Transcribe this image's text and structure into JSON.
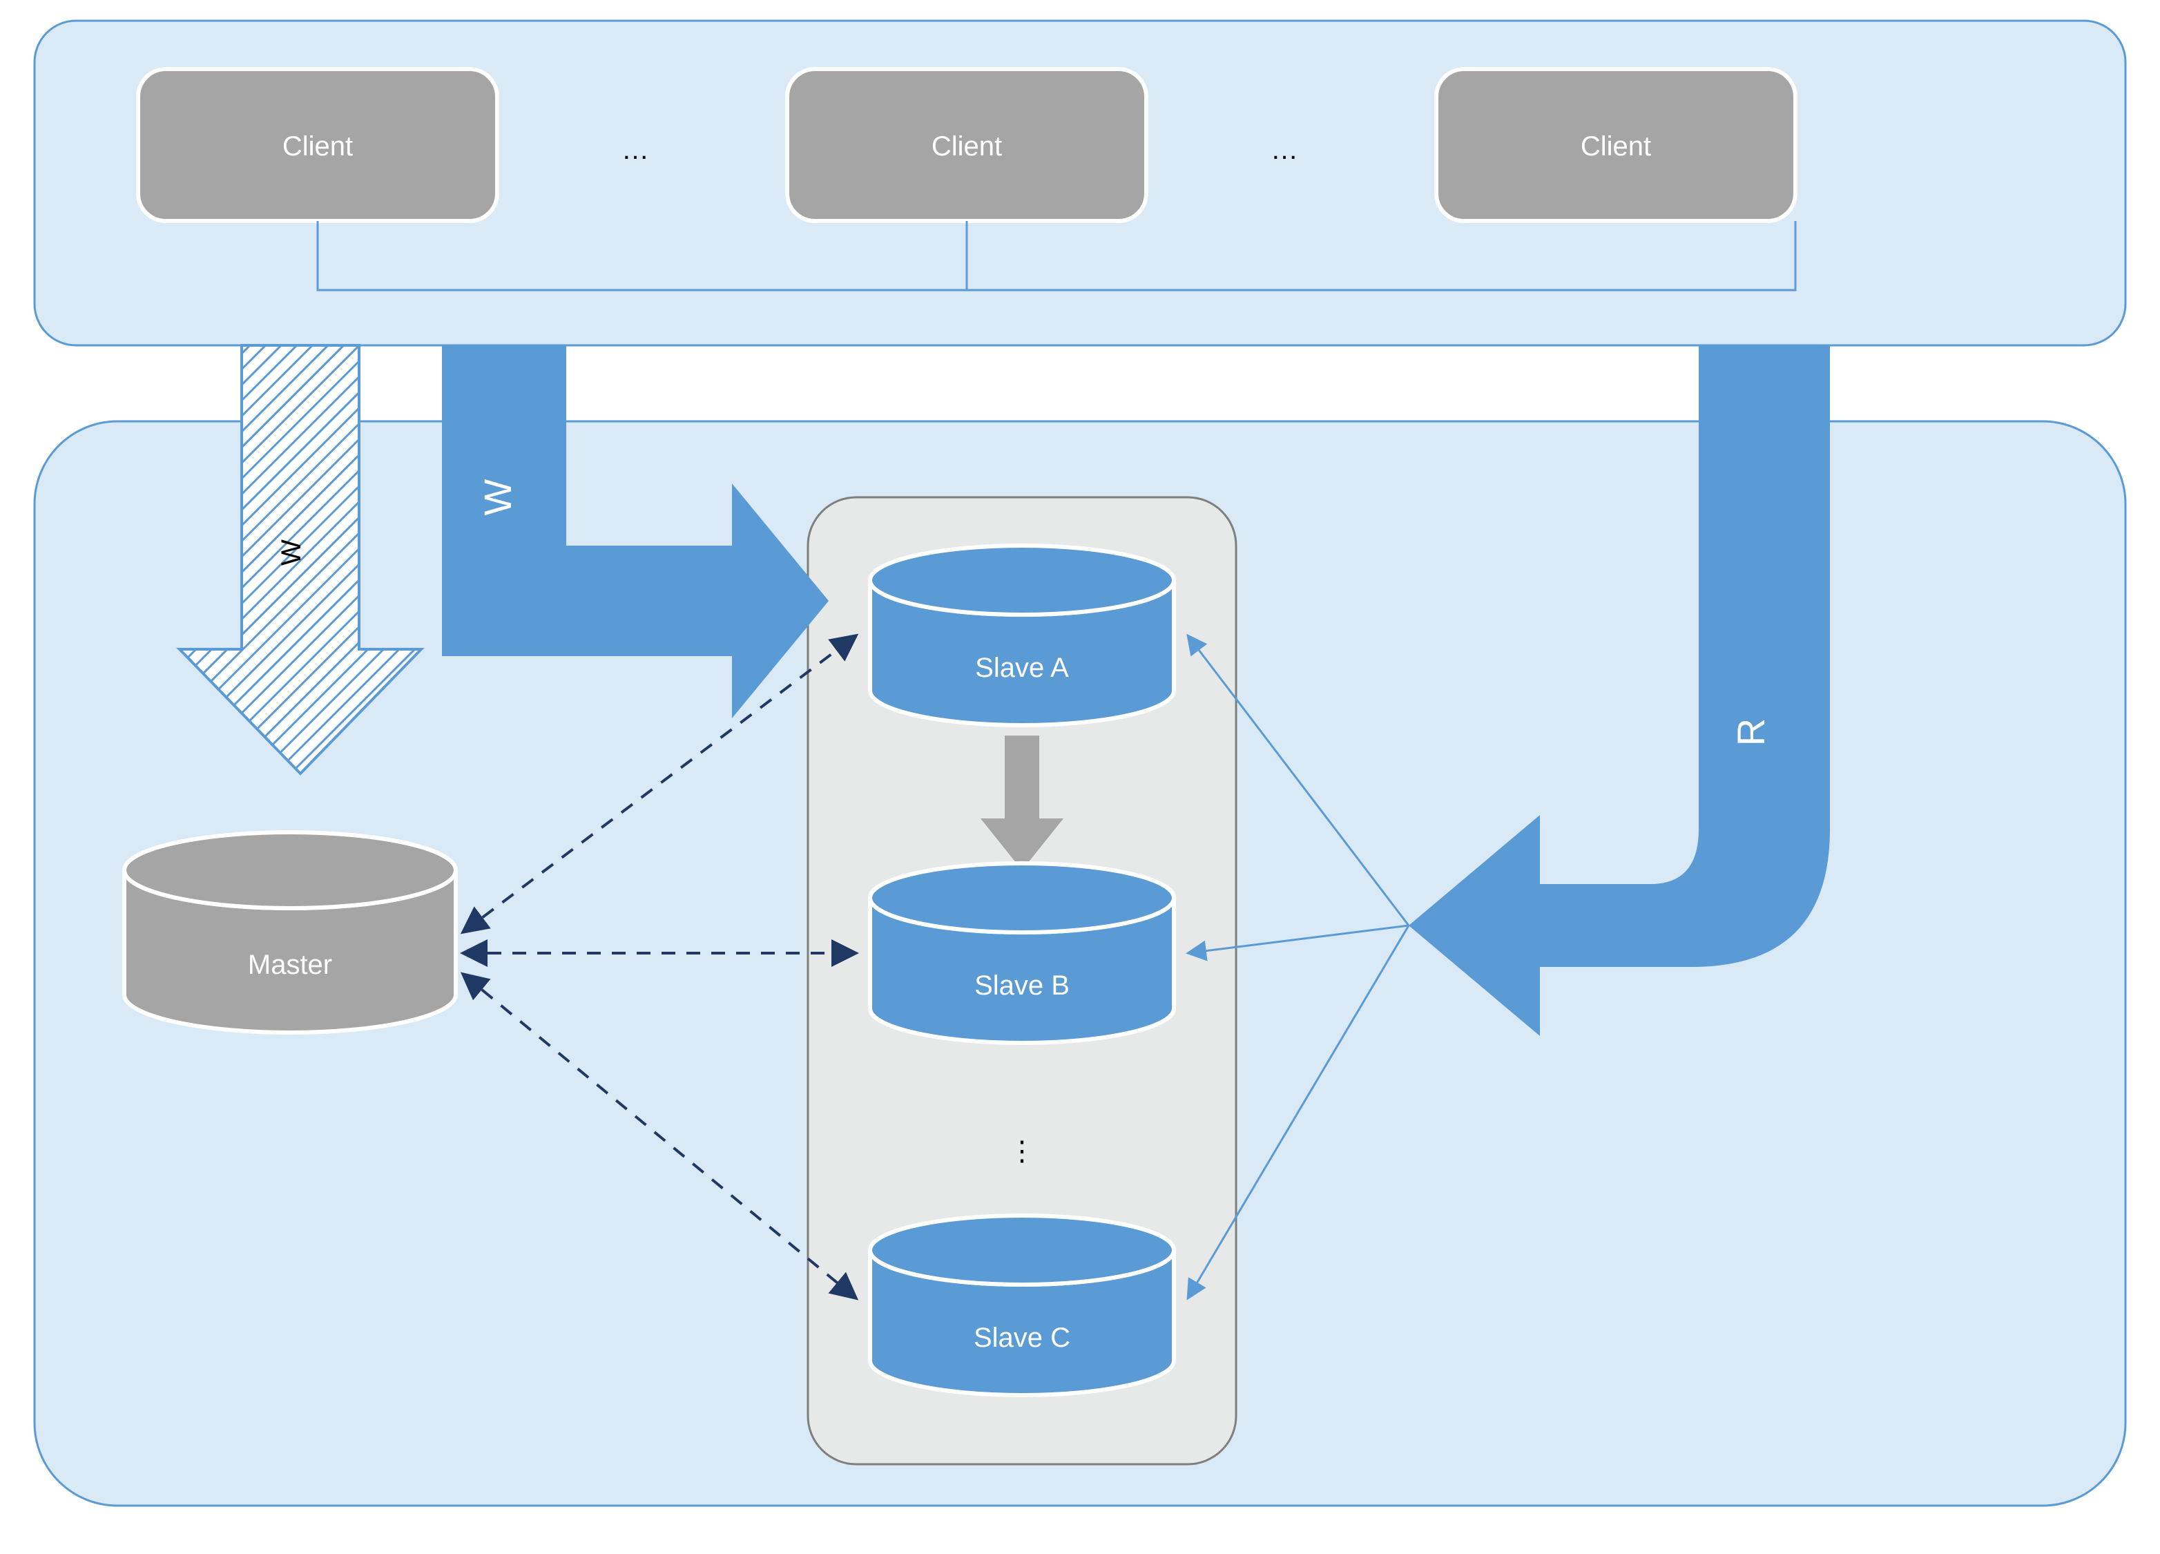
{
  "clients": {
    "label": "Client",
    "ellipsis": "…"
  },
  "nodes": {
    "master": "Master",
    "slaves": {
      "a": "Slave A",
      "b": "Slave B",
      "c": "Slave C",
      "ellipsis": "⋮"
    }
  },
  "arrows": {
    "write_hatched": "W",
    "write_solid": "W",
    "read": "R"
  },
  "colors": {
    "background_panel": "#dae9f6",
    "slave_panel": "#e7e8e8",
    "blue": "#5b9bd5",
    "grey": "#a5a5a5",
    "grey_stroke": "#7f7f7f",
    "dark_blue": "#1f3864"
  },
  "diagram_description": "Master-slave database replication architecture. Multiple clients write (W) to the master or directly to Slave A. Master replicates to Slaves A, B, C (dashed arrows). Slave A propagates to Slave B. Clients read (R) from any slave."
}
